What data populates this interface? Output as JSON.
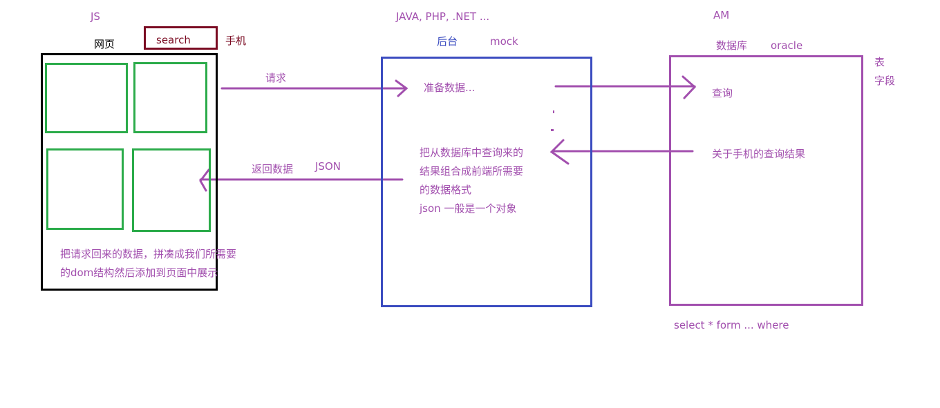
{
  "colors": {
    "purple": "#a24fae",
    "blue": "#3b4cc0",
    "green": "#2bab4a",
    "black": "#000000",
    "darkred": "#7a0b22"
  },
  "frontend": {
    "js_label": "JS",
    "page_label": "网页",
    "search_label": "search",
    "phone_label": "手机",
    "note_line1": "把请求回来的数据，拼凑成我们所需要",
    "note_line2": "的dom结构然后添加到页面中展示"
  },
  "backend": {
    "languages_label": "JAVA, PHP, .NET ...",
    "backend_label": "后台",
    "mock_label": "mock",
    "prepare_label": "准备数据...",
    "desc_line1": "把从数据库中查询来的",
    "desc_line2": "结果组合成前端所需要",
    "desc_line3": "的数据格式",
    "desc_line4": "json 一般是一个对象"
  },
  "database": {
    "am_label": "AM",
    "db_label": "数据库",
    "oracle_label": "oracle",
    "table_label": "表",
    "field_label": "字段",
    "query_label": "查询",
    "result_label": "关于手机的查询结果",
    "sql_label": "select * form ... where"
  },
  "arrows": {
    "request_label": "请求",
    "return_label": "返回数据",
    "json_label": "JSON"
  }
}
